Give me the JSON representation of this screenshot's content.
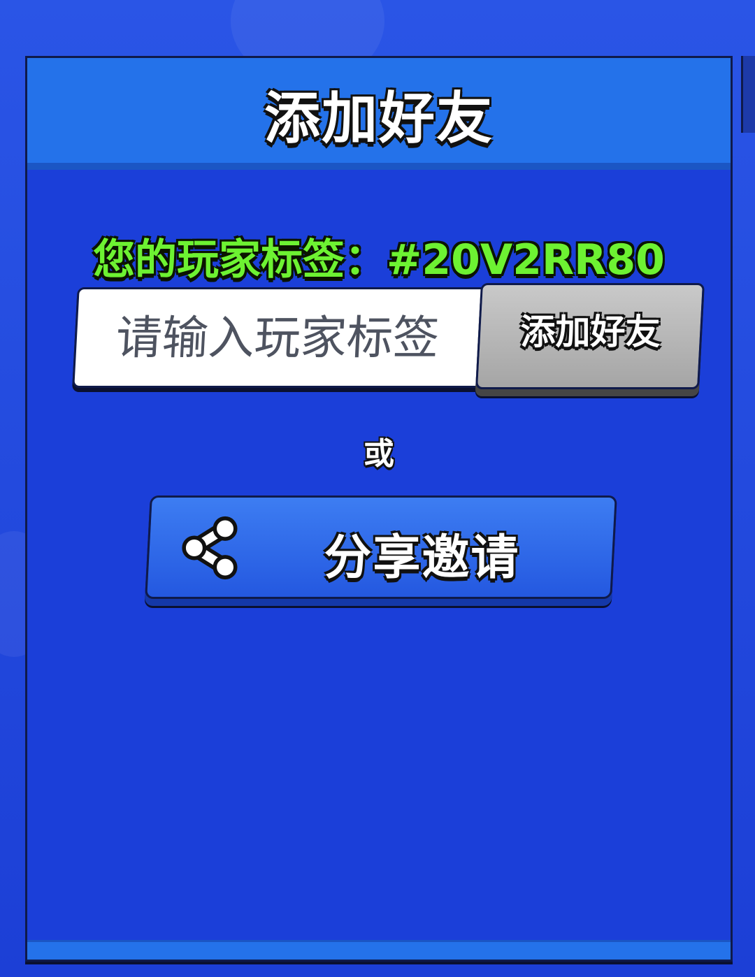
{
  "dialog": {
    "title": "添加好友",
    "player_tag_text": "您的玩家标签：#20V2RR80"
  },
  "tag_input": {
    "value": "",
    "placeholder": "请输入玩家标签"
  },
  "add_friend_button": {
    "label": "添加好友"
  },
  "separator": {
    "text": "或"
  },
  "share_button": {
    "label": "分享邀请",
    "icon": "share-icon"
  },
  "colors": {
    "panel_bg": "#1b3fd9",
    "header_bg": "#2472ea",
    "tag_green": "#6df232",
    "button_gray": "#b5b5b5",
    "button_blue": "#2f6ae8"
  }
}
